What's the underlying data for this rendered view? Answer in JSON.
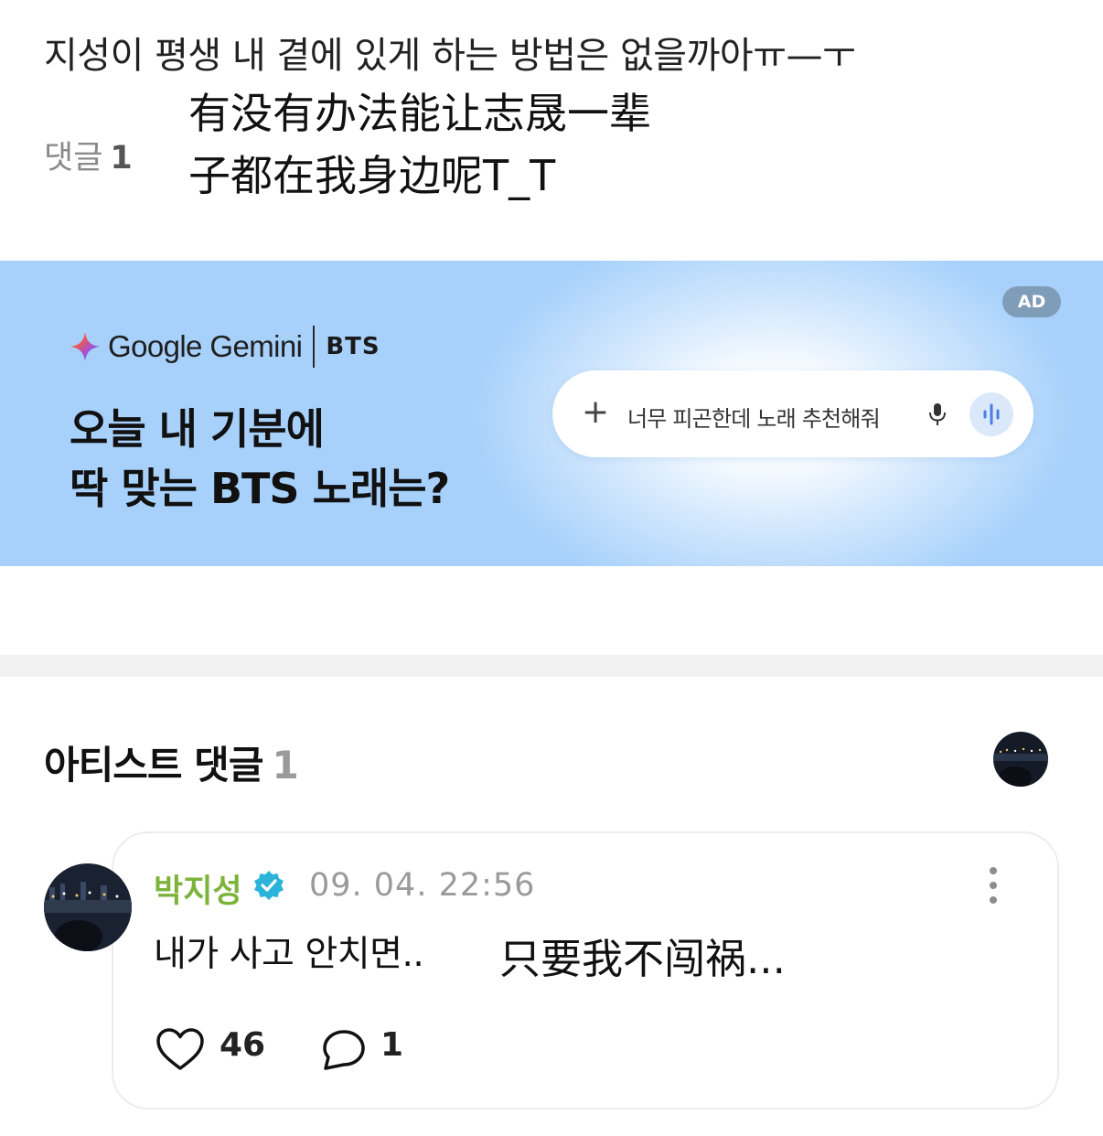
{
  "post": {
    "text": "지성이 평생 내 곁에 있게 하는 방법은 없을까아ㅠ—ㅜ",
    "translation_line1": "有没有办法能让志晟一辈",
    "translation_line2": "子都在我身边呢T_T",
    "comment_label": "댓글",
    "comment_count": "1"
  },
  "ad": {
    "badge": "AD",
    "brand": "Google Gemini",
    "partner": "BTS",
    "headline_line1": "오늘 내 기분에",
    "headline_line2": "딱 맞는 BTS 노래는?",
    "prompt": "너무 피곤한데 노래 추천해줘",
    "icons": [
      "gemini-spark-icon",
      "plus-icon",
      "microphone-icon",
      "voice-wave-icon"
    ]
  },
  "artist_comments": {
    "title": "아티스트 댓글",
    "count": "1"
  },
  "comment": {
    "author": "박지성",
    "timestamp": "09. 04. 22:56",
    "text": "내가 사고 안치면..",
    "translation": "只要我不闯祸...",
    "likes": "46",
    "replies": "1",
    "author_color": "#7cb339",
    "verified_color": "#2bb3d9"
  }
}
